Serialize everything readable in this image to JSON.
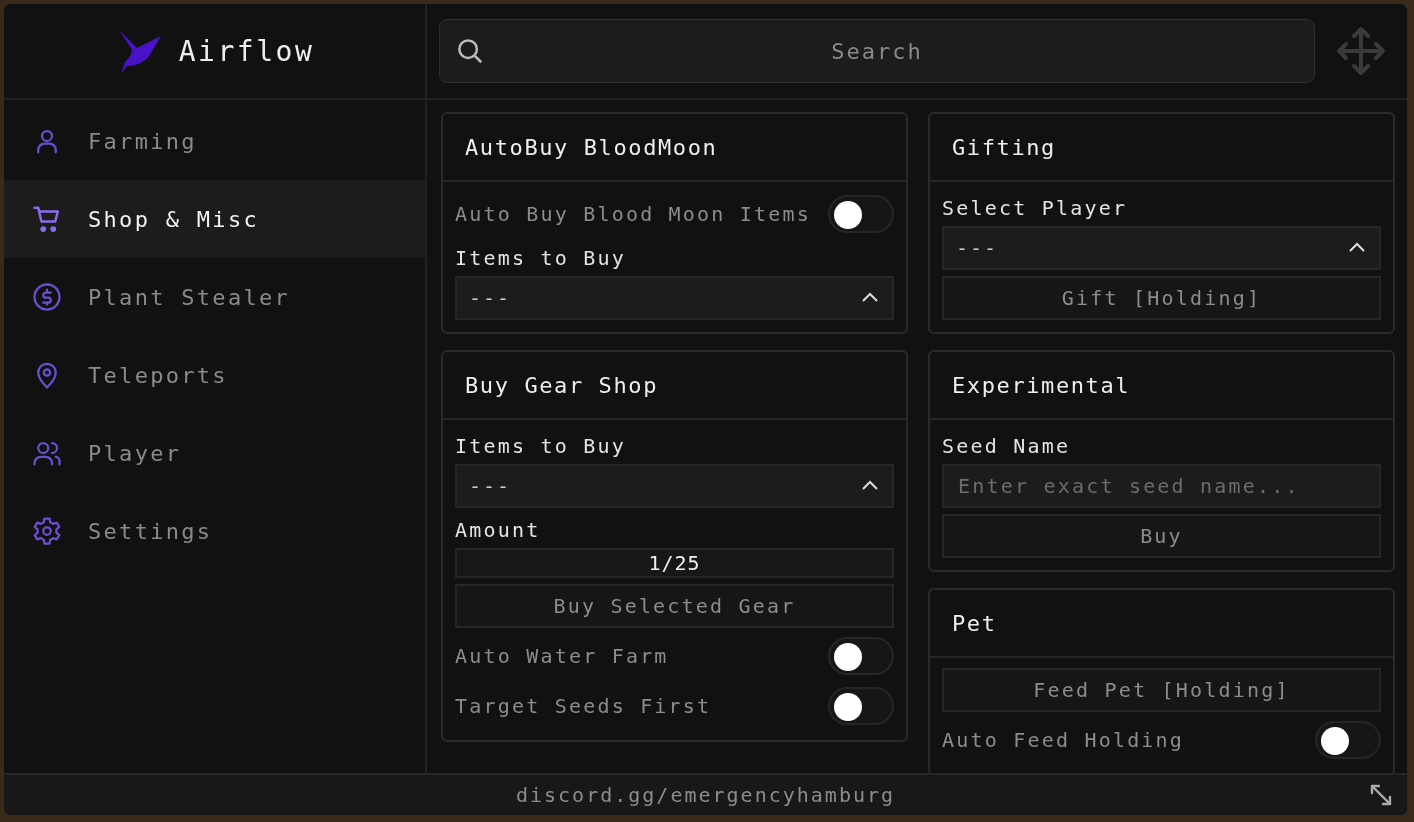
{
  "app": {
    "title": "Airflow"
  },
  "search": {
    "placeholder": "Search"
  },
  "sidebar": {
    "items": [
      {
        "label": "Farming",
        "selected": false
      },
      {
        "label": "Shop & Misc",
        "selected": true
      },
      {
        "label": "Plant Stealer",
        "selected": false
      },
      {
        "label": "Teleports",
        "selected": false
      },
      {
        "label": "Player",
        "selected": false
      },
      {
        "label": "Settings",
        "selected": false
      }
    ]
  },
  "columns": [
    [
      {
        "title": "AutoBuy BloodMoon",
        "controls": [
          {
            "kind": "toggle",
            "label": "Auto Buy Blood Moon Items",
            "on": false
          },
          {
            "kind": "label",
            "text": "Items to Buy"
          },
          {
            "kind": "dropdown",
            "value": "---"
          }
        ]
      },
      {
        "title": "Buy Gear Shop",
        "controls": [
          {
            "kind": "label",
            "text": "Items to Buy"
          },
          {
            "kind": "dropdown",
            "value": "---"
          },
          {
            "kind": "label",
            "text": "Amount"
          },
          {
            "kind": "slider",
            "value": "1/25",
            "level": 0
          },
          {
            "kind": "button",
            "label": "Buy Selected Gear"
          },
          {
            "kind": "toggle",
            "label": "Auto Water Farm",
            "on": false
          },
          {
            "kind": "toggle",
            "label": "Target Seeds First",
            "on": false
          }
        ]
      }
    ],
    [
      {
        "title": "Gifting",
        "controls": [
          {
            "kind": "label",
            "text": "Select Player"
          },
          {
            "kind": "dropdown",
            "value": "---"
          },
          {
            "kind": "button",
            "label": "Gift [Holding]"
          }
        ]
      },
      {
        "title": "Experimental",
        "controls": [
          {
            "kind": "label",
            "text": "Seed Name"
          },
          {
            "kind": "input",
            "placeholder": "Enter exact seed name..."
          },
          {
            "kind": "button",
            "label": "Buy"
          }
        ]
      },
      {
        "title": "Pet",
        "controls": [
          {
            "kind": "button",
            "label": "Feed Pet [Holding]"
          },
          {
            "kind": "toggle",
            "label": "Auto Feed Holding",
            "on": false
          }
        ]
      }
    ]
  ],
  "footer": {
    "text": "discord.gg/emergencyhamburg"
  }
}
